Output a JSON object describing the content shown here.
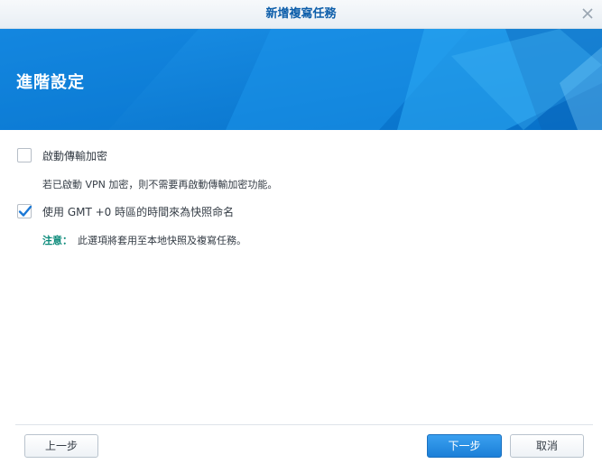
{
  "window": {
    "title": "新增複寫任務",
    "close_icon": "close-icon"
  },
  "banner": {
    "heading": "進階設定",
    "accent_color": "#0e83de"
  },
  "options": [
    {
      "label": "啟動傳輸加密",
      "checked": false,
      "hint": "若已啟動 VPN 加密，則不需要再啟動傳輸加密功能。"
    },
    {
      "label": "使用 GMT +0 時區的時間來為快照命名",
      "checked": true,
      "note_key": "注意：",
      "note_text": "此選項將套用至本地快照及複寫任務。"
    }
  ],
  "buttons": {
    "back": "上一步",
    "next": "下一步",
    "cancel": "取消"
  }
}
